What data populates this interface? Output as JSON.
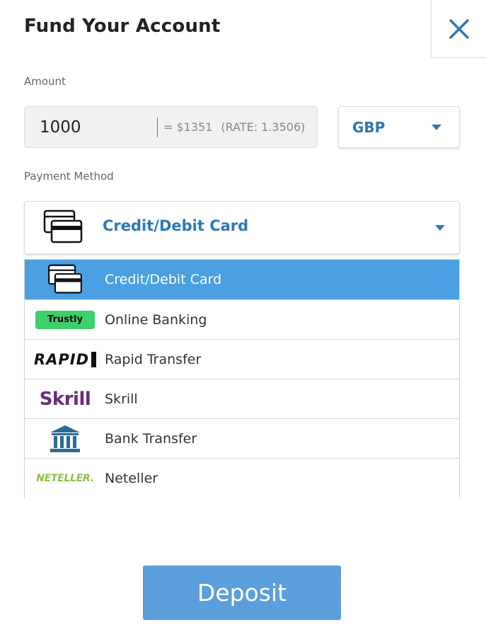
{
  "header": {
    "title": "Fund Your Account",
    "close_icon": "close-icon"
  },
  "amount": {
    "label": "Amount",
    "value": "1000",
    "converted": "= $1351",
    "rate": "(RATE: 1.3506)"
  },
  "currency": {
    "selected": "GBP",
    "icon": "chevron-down-icon"
  },
  "payment": {
    "label": "Payment Method",
    "selected": "Credit/Debit Card",
    "selected_icon": "credit-card-icon",
    "options": [
      {
        "label": "Credit/Debit Card",
        "icon": "credit-card-icon",
        "selected": true
      },
      {
        "label": "Online Banking",
        "icon": "trustly-logo",
        "logo_text": "Trustly"
      },
      {
        "label": "Rapid Transfer",
        "icon": "rapid-transfer-logo",
        "logo_text": "RAPID"
      },
      {
        "label": "Skrill",
        "icon": "skrill-logo",
        "logo_text": "Skrill"
      },
      {
        "label": "Bank Transfer",
        "icon": "bank-icon"
      },
      {
        "label": "Neteller",
        "icon": "neteller-logo",
        "logo_text": "NETELLER."
      }
    ]
  },
  "actions": {
    "deposit_label": "Deposit"
  },
  "colors": {
    "accent": "#2d78b7",
    "selected_row": "#4aa0e3",
    "deposit_button": "#5b9fdd",
    "trustly_green": "#3ccf6a",
    "skrill_purple": "#6a2a7a",
    "neteller_green": "#8bc34a"
  }
}
